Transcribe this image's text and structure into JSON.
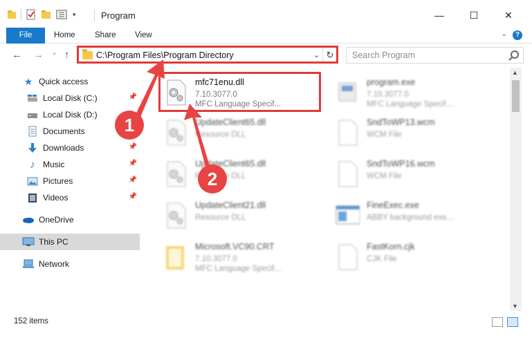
{
  "window": {
    "title": "Program",
    "minimize": "—",
    "maximize": "☐",
    "close": "✕"
  },
  "ribbon": {
    "tabs": [
      "File",
      "Home",
      "Share",
      "View"
    ],
    "help": "?"
  },
  "navigation": {
    "back": "←",
    "forward": "→",
    "recent": "⌄",
    "up": "↑",
    "address": "C:\\Program Files\\Program Directory",
    "refresh": "↻",
    "search_placeholder": "Search Program"
  },
  "sidebar": {
    "items": [
      {
        "label": "Quick access",
        "icon": "star-icon"
      },
      {
        "label": "Local Disk (C:)",
        "icon": "drive-icon"
      },
      {
        "label": "Local Disk (D:)",
        "icon": "drive-icon"
      },
      {
        "label": "Documents",
        "icon": "documents-icon"
      },
      {
        "label": "Downloads",
        "icon": "download-icon"
      },
      {
        "label": "Music",
        "icon": "music-icon"
      },
      {
        "label": "Pictures",
        "icon": "pictures-icon"
      },
      {
        "label": "Videos",
        "icon": "videos-icon"
      },
      {
        "label": "OneDrive",
        "icon": "cloud-icon"
      },
      {
        "label": "This PC",
        "icon": "computer-icon"
      },
      {
        "label": "Network",
        "icon": "network-icon"
      }
    ]
  },
  "files": [
    {
      "name": "mfc71enu.dll",
      "line1": "7.10.3077.0",
      "line2": "MFC Language Specif...",
      "icon": "dll-gear-icon"
    },
    {
      "name": "program.exe",
      "line1": "7.10.3077.0",
      "line2": "MFC Language Specif...",
      "icon": "exe-icon"
    },
    {
      "name": "UpdateClient65.dll",
      "line1": "Resource DLL",
      "line2": "",
      "icon": "dll-gear-icon"
    },
    {
      "name": "SndToWP13.wcm",
      "line1": "WCM File",
      "line2": "",
      "icon": "blank-file-icon"
    },
    {
      "name": "UpdateClient65.dll",
      "line1": "Resource DLL",
      "line2": "",
      "icon": "dll-gear-icon"
    },
    {
      "name": "SndToWP16.wcm",
      "line1": "WCM File",
      "line2": "",
      "icon": "blank-file-icon"
    },
    {
      "name": "UpdateClient21.dll",
      "line1": "Resource DLL",
      "line2": "",
      "icon": "dll-gear-icon"
    },
    {
      "name": "FineExec.exe",
      "line1": "ABBY background exe...",
      "line2": "",
      "icon": "exe-window-icon"
    },
    {
      "name": "Microsoft.VC90.CRT",
      "line1": "7.10.3077.0",
      "line2": "MFC Language Specif...",
      "icon": "folder-icon"
    },
    {
      "name": "FastKorn.cjk",
      "line1": "CJK File",
      "line2": "",
      "icon": "blank-file-icon"
    }
  ],
  "status": {
    "item_count": "152 items"
  },
  "annotations": {
    "step1": "1",
    "step2": "2"
  },
  "colors": {
    "accent": "#1979ca",
    "highlight": "#e03a3a",
    "badge": "#e84444",
    "selected": "#d9d9d9"
  }
}
